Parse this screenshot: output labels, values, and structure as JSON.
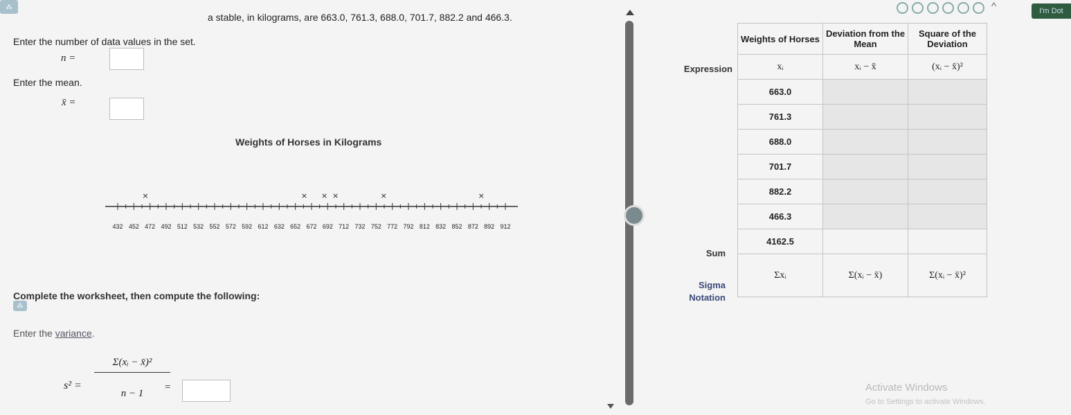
{
  "problem": {
    "top_text": "a stable, in kilograms, are 663.0, 761.3, 688.0, 701.7, 882.2 and 466.3.",
    "n_prompt": "Enter the number of data values in the set.",
    "n_label": "n =",
    "mean_prompt": "Enter the mean.",
    "mean_label": "x̄ =",
    "chart_title": "Weights of Horses in Kilograms",
    "complete_text": "Complete the worksheet, then compute the following:",
    "variance_prompt_pre": "Enter the ",
    "variance_link": "variance",
    "variance_prompt_post": ".",
    "variance_lhs": "s² =",
    "variance_num": "Σ(xᵢ − x̄)²",
    "variance_den": "n − 1",
    "variance_eq": "="
  },
  "top_right": {
    "badge": "I'm Dot",
    "caret": "^"
  },
  "watermark": {
    "title": "Activate Windows",
    "subtitle": "Go to Settings to activate Windows."
  },
  "worksheet": {
    "headers": [
      "Weights of Horses",
      "Deviation from the Mean",
      "Square of the Deviation"
    ],
    "expression_label": "Expression",
    "expressions": [
      "xᵢ",
      "xᵢ − x̄",
      "(xᵢ − x̄)²"
    ],
    "rows": [
      "663.0",
      "761.3",
      "688.0",
      "701.7",
      "882.2",
      "466.3"
    ],
    "sum_label": "Sum",
    "sum_value": "4162.5",
    "sigma_label_1": "Sigma",
    "sigma_label_2": "Notation",
    "sigma": [
      "Σxᵢ",
      "Σ(xᵢ − x̄)",
      "Σ(xᵢ − x̄)²"
    ]
  },
  "chart_data": {
    "type": "scatter",
    "title": "Weights of Horses in Kilograms",
    "ticks": [
      432,
      452,
      472,
      492,
      512,
      532,
      552,
      572,
      592,
      612,
      632,
      652,
      672,
      692,
      712,
      732,
      752,
      772,
      792,
      812,
      832,
      852,
      872,
      892,
      912
    ],
    "xlim": [
      432,
      912
    ],
    "points": [
      466.3,
      663.0,
      688.0,
      701.7,
      761.3,
      882.2
    ],
    "marker": "×"
  }
}
